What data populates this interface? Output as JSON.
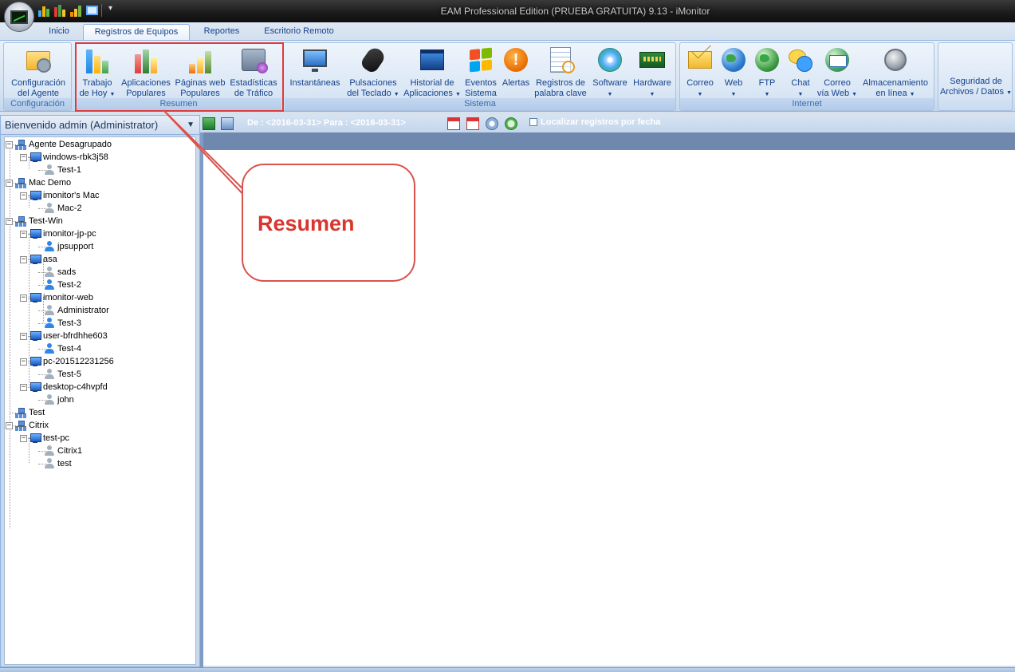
{
  "window": {
    "title": "EAM Professional Edition (PRUEBA GRATUITA) 9.13 - iMonitor"
  },
  "tabs": [
    {
      "label": "Inicio"
    },
    {
      "label": "Registros de Equipos",
      "active": true
    },
    {
      "label": "Reportes"
    },
    {
      "label": "Escritorio Remoto"
    }
  ],
  "ribbon": {
    "groups": {
      "configuracion": "Configuración",
      "resumen": "Resumen",
      "sistema": "Sistema",
      "internet": "Internet"
    },
    "buttons": {
      "config_agente": [
        "Configuración",
        "del Agente"
      ],
      "trabajo_hoy": [
        "Trabajo",
        "de Hoy"
      ],
      "aplicaciones": [
        "Aplicaciones",
        "Populares"
      ],
      "paginas_web": [
        "Páginas web",
        "Populares"
      ],
      "estadisticas": [
        "Estadísticas",
        "de Tráfico"
      ],
      "instantaneas": [
        "Instantáneas",
        ""
      ],
      "pulsaciones": [
        "Pulsaciones",
        "del Teclado"
      ],
      "historial": [
        "Historial de",
        "Aplicaciones"
      ],
      "eventos": [
        "Eventos",
        "Sistema"
      ],
      "alertas": [
        "Alertas",
        ""
      ],
      "registros_palabra": [
        "Registros de",
        "palabra clave"
      ],
      "software": [
        "Software",
        ""
      ],
      "hardware": [
        "Hardware",
        ""
      ],
      "correo": [
        "Correo",
        ""
      ],
      "web": [
        "Web",
        ""
      ],
      "ftp": [
        "FTP",
        ""
      ],
      "chat": [
        "Chat",
        ""
      ],
      "correo_web": [
        "Correo",
        "vía Web"
      ],
      "almacenamiento": [
        "Almacenamiento",
        "en línea"
      ],
      "seguridad": [
        "Seguridad de",
        "Archivos / Datos"
      ]
    }
  },
  "annotation": {
    "label": "Resumen"
  },
  "left_panel": {
    "header": "Bienvenido admin (Administrator)",
    "tree": [
      "Agente Desagrupado",
      "windows-rbk3j58",
      "Test-1",
      "Mac Demo",
      "imonitor's Mac",
      "Mac-2",
      "Test-Win",
      "imonitor-jp-pc",
      "jpsupport",
      "asa",
      "sads",
      "Test-2",
      "imonitor-web",
      "Administrator",
      "Test-3",
      "user-bfrdhhe603",
      "Test-4",
      "pc-201512231256",
      "Test-5",
      "desktop-c4hvpfd",
      "john",
      "Test",
      "Citrix",
      "test-pc",
      "Citrix1",
      "test"
    ]
  },
  "toolbar": {
    "date_range": "De : <2016-03-31> Para : <2016-03-31>",
    "locate_label": "Localizar registros por fecha"
  },
  "colors": {
    "accent": "#15428b",
    "annotation": "#e03a3a",
    "header_strip": "#6f88ad"
  }
}
